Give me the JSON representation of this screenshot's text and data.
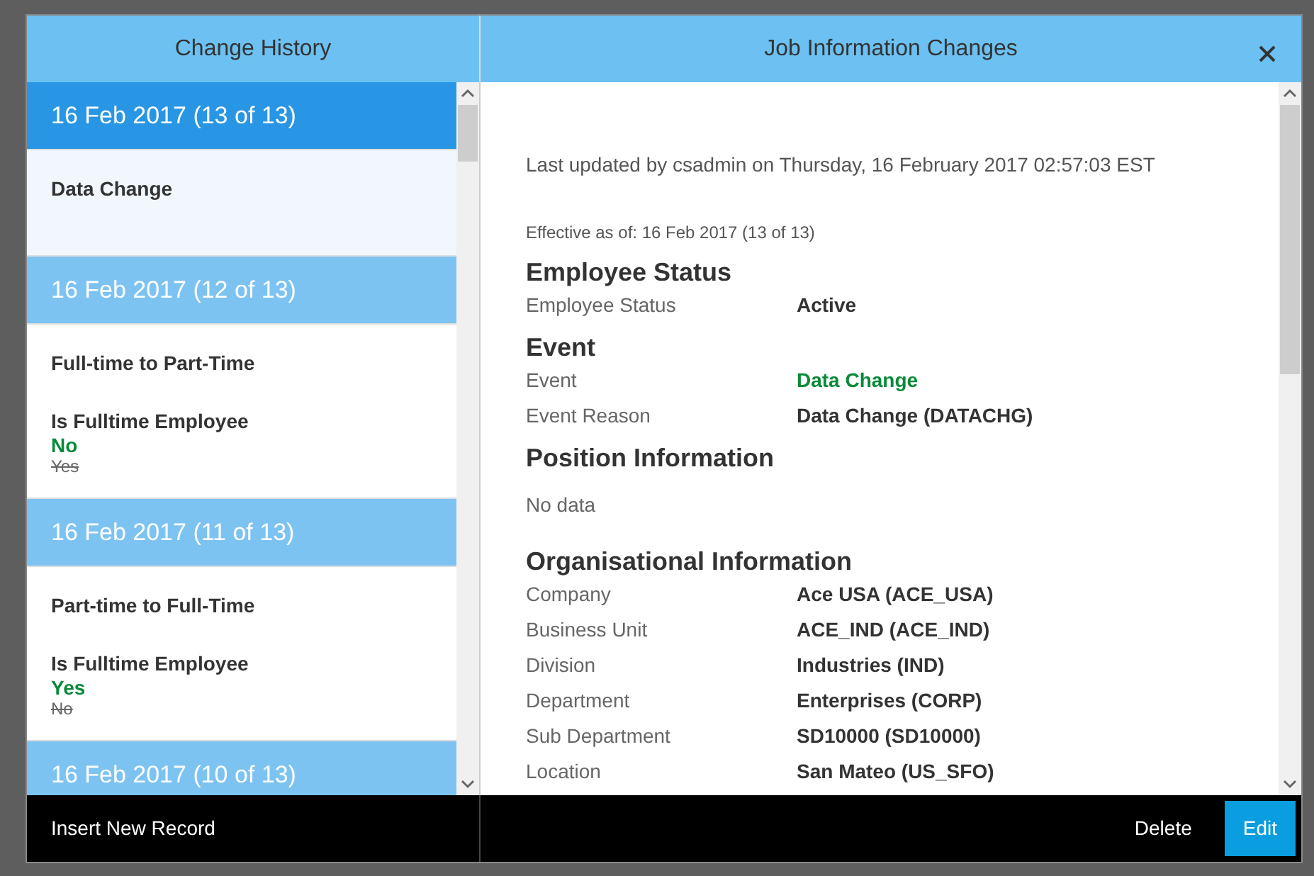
{
  "dialog": {
    "history_title": "Change History",
    "detail_title": "Job Information Changes"
  },
  "history": [
    {
      "date": "16 Feb 2017 (13 of 13)",
      "selected": true,
      "changes": [
        {
          "kind": "event",
          "title": "Data Change"
        }
      ]
    },
    {
      "date": "16 Feb 2017 (12 of 13)",
      "selected": false,
      "changes": [
        {
          "kind": "event",
          "title": "Full-time to Part-Time"
        },
        {
          "kind": "field",
          "field": "Is Fulltime Employee",
          "new_value": "No",
          "old_value": "Yes"
        }
      ]
    },
    {
      "date": "16 Feb 2017 (11 of 13)",
      "selected": false,
      "changes": [
        {
          "kind": "event",
          "title": "Part-time to Full-Time"
        },
        {
          "kind": "field",
          "field": "Is Fulltime Employee",
          "new_value": "Yes",
          "old_value": "No"
        }
      ]
    },
    {
      "date": "16 Feb 2017 (10 of 13)",
      "selected": false
    }
  ],
  "detail": {
    "last_updated": "Last updated by csadmin on Thursday, 16 February 2017 02:57:03 EST",
    "effective": "Effective as of: 16 Feb 2017 (13 of 13)",
    "sections": [
      {
        "heading": "Employee Status",
        "rows": [
          {
            "label": "Employee Status",
            "value": "Active",
            "highlight": false
          }
        ]
      },
      {
        "heading": "Event",
        "rows": [
          {
            "label": "Event",
            "value": "Data Change",
            "highlight": true
          },
          {
            "label": "Event Reason",
            "value": "Data Change (DATACHG)",
            "highlight": false
          }
        ]
      },
      {
        "heading": "Position Information",
        "empty_text": "No data"
      },
      {
        "heading": "Organisational Information",
        "rows": [
          {
            "label": "Company",
            "value": "Ace USA (ACE_USA)",
            "highlight": false
          },
          {
            "label": "Business Unit",
            "value": "ACE_IND (ACE_IND)",
            "highlight": false
          },
          {
            "label": "Division",
            "value": "Industries (IND)",
            "highlight": false
          },
          {
            "label": "Department",
            "value": "Enterprises (CORP)",
            "highlight": false
          },
          {
            "label": "Sub Department",
            "value": "SD10000 (SD10000)",
            "highlight": false
          },
          {
            "label": "Location",
            "value": "San Mateo (US_SFO)",
            "highlight": false
          }
        ]
      }
    ]
  },
  "footer": {
    "insert_button": "Insert New Record",
    "delete_button": "Delete",
    "edit_button": "Edit"
  }
}
